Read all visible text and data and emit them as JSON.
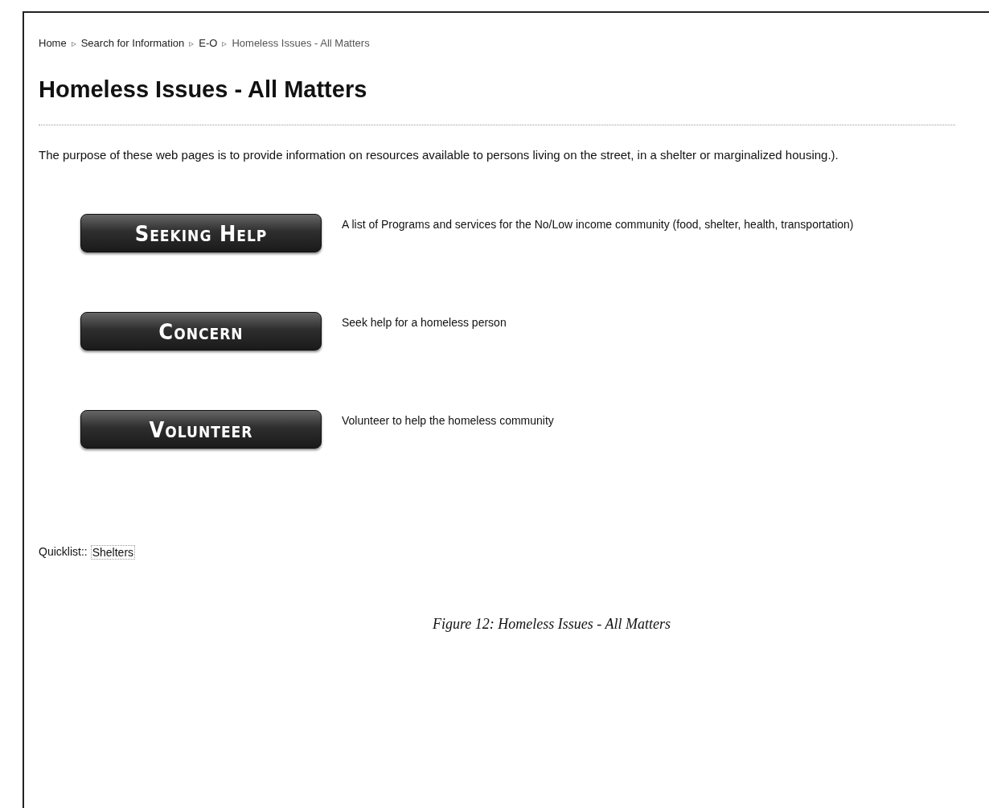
{
  "breadcrumb": [
    {
      "label": "Home",
      "separator": "▹"
    },
    {
      "label": "Search for Information",
      "separator": "▹"
    },
    {
      "label": "E-O",
      "separator": "▹"
    },
    {
      "label": "Homeless Issues - All Matters"
    }
  ],
  "title": "Homeless Issues - All Matters",
  "intro": "The purpose of these web pages is to provide information on resources available to persons living on the street, in a shelter or marginalized housing.).",
  "links": [
    {
      "button": "Seeking Help",
      "description": "A list of Programs and services for the No/Low income community (food, shelter, health, transportation)"
    },
    {
      "button": "Concern",
      "description": "Seek help for a homeless person"
    },
    {
      "button": "Volunteer",
      "description": "Volunteer to help the homeless community"
    }
  ],
  "quicklist": {
    "label": "Quicklist::",
    "link": "Shelters"
  },
  "caption": "Figure 12: Homeless Issues - All Matters"
}
